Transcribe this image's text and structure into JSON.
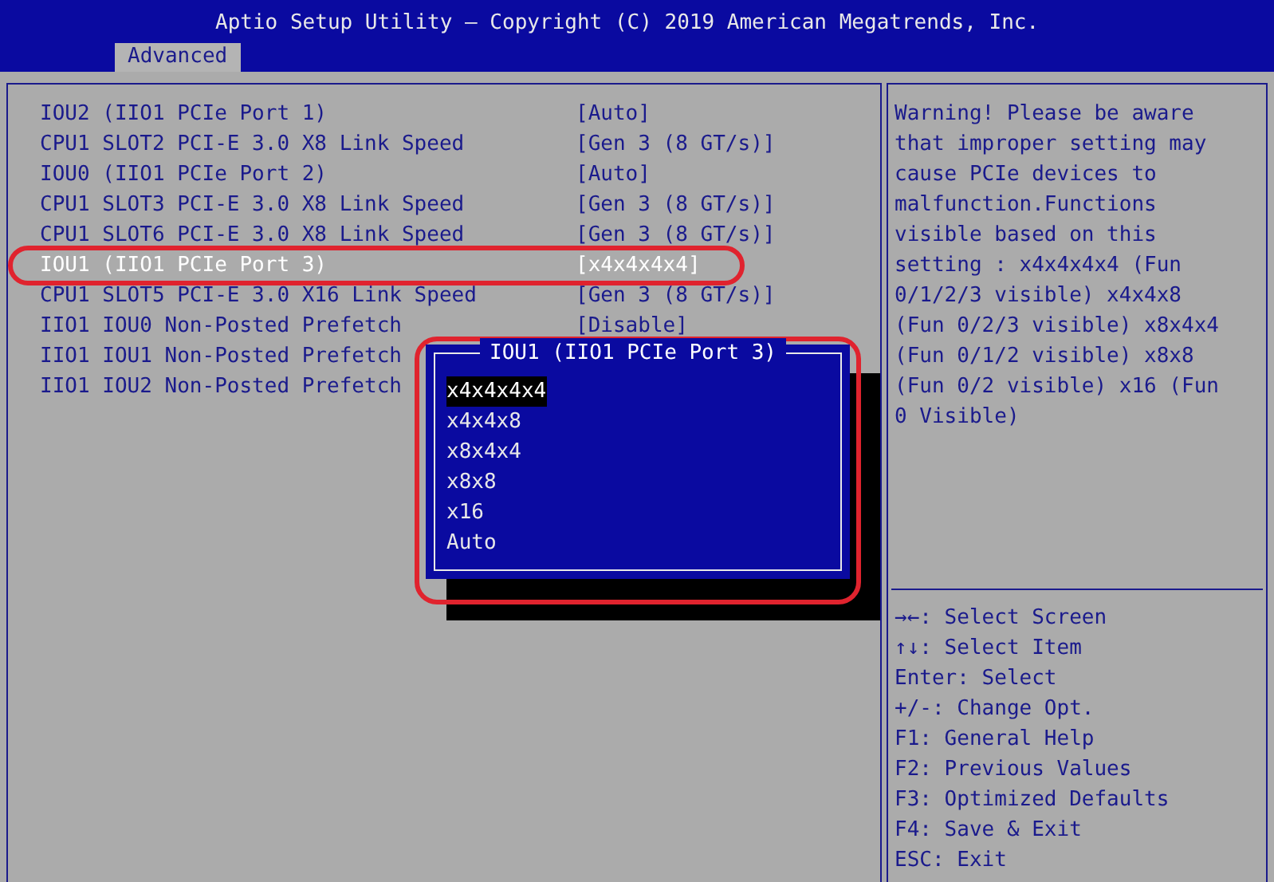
{
  "header": {
    "title": "Aptio Setup Utility – Copyright (C) 2019 American Megatrends, Inc.",
    "tabs": [
      {
        "label": "Advanced",
        "selected": true
      }
    ]
  },
  "settings": [
    {
      "label": "IOU2 (IIO1 PCIe Port 1)",
      "value": "[Auto]",
      "selected": false
    },
    {
      "label": "CPU1 SLOT2 PCI-E 3.0 X8 Link Speed",
      "value": "[Gen 3 (8 GT/s)]",
      "selected": false
    },
    {
      "label": "IOU0 (IIO1 PCIe Port 2)",
      "value": "[Auto]",
      "selected": false
    },
    {
      "label": "CPU1 SLOT3 PCI-E 3.0 X8 Link Speed",
      "value": "[Gen 3 (8 GT/s)]",
      "selected": false
    },
    {
      "label": "CPU1 SLOT6 PCI-E 3.0 X8 Link Speed",
      "value": "[Gen 3 (8 GT/s)]",
      "selected": false
    },
    {
      "label": "IOU1 (IIO1 PCIe Port 3)",
      "value": "[x4x4x4x4]",
      "selected": true
    },
    {
      "label": "CPU1 SLOT5 PCI-E 3.0 X16 Link Speed",
      "value": "[Gen 3 (8 GT/s)]",
      "selected": false
    },
    {
      "label": "IIO1 IOU0 Non-Posted Prefetch",
      "value": "[Disable]",
      "selected": false
    },
    {
      "label": "IIO1 IOU1 Non-Posted Prefetch",
      "selected": false
    },
    {
      "label": "IIO1 IOU2 Non-Posted Prefetch",
      "selected": false
    }
  ],
  "popup": {
    "title": "IOU1 (IIO1 PCIe Port 3)",
    "options": [
      {
        "label": "x4x4x4x4",
        "selected": true
      },
      {
        "label": "x4x4x8",
        "selected": false
      },
      {
        "label": "x8x4x4",
        "selected": false
      },
      {
        "label": "x8x8",
        "selected": false
      },
      {
        "label": "x16",
        "selected": false
      },
      {
        "label": "Auto",
        "selected": false
      }
    ]
  },
  "help_text": "Warning! Please be aware that improper setting may cause PCIe devices to malfunction.Functions visible based on this setting : x4x4x4x4 (Fun 0/1/2/3 visible) x4x4x8 (Fun 0/2/3 visible) x8x4x4 (Fun 0/1/2 visible) x8x8 (Fun 0/2 visible) x16 (Fun 0 Visible)",
  "key_help": [
    "→←: Select Screen",
    "↑↓: Select Item",
    "Enter: Select",
    "+/-: Change Opt.",
    "F1: General Help",
    "F2: Previous Values",
    "F3: Optimized Defaults",
    "F4: Save & Exit",
    "ESC: Exit"
  ]
}
